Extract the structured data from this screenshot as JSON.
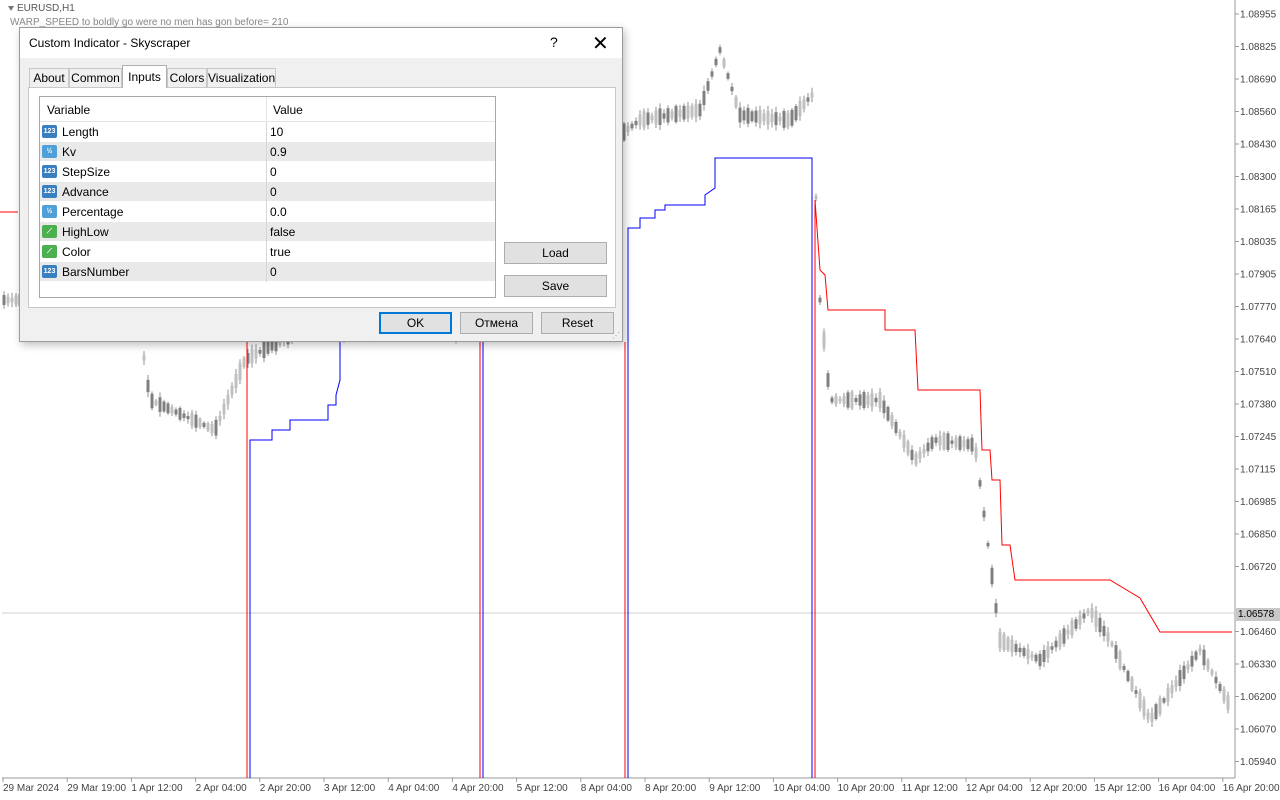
{
  "chart": {
    "symbol": "EURUSD,H1",
    "indicator_note": "WARP_SPEED to boldly go were no men has gon before= 210",
    "current_price": "1.06578",
    "price_ticks": [
      "1.08955",
      "1.08825",
      "1.08690",
      "1.08560",
      "1.08430",
      "1.08300",
      "1.08165",
      "1.08035",
      "1.07905",
      "1.07770",
      "1.07640",
      "1.07510",
      "1.07380",
      "1.07245",
      "1.07115",
      "1.06985",
      "1.06850",
      "1.06720",
      "1.06460",
      "1.06330",
      "1.06200",
      "1.06070",
      "1.05940"
    ],
    "time_ticks": [
      "29 Mar 2024",
      "29 Mar 19:00",
      "1 Apr 12:00",
      "2 Apr 04:00",
      "2 Apr 20:00",
      "3 Apr 12:00",
      "4 Apr 04:00",
      "4 Apr 20:00",
      "5 Apr 12:00",
      "8 Apr 04:00",
      "8 Apr 20:00",
      "9 Apr 12:00",
      "10 Apr 04:00",
      "10 Apr 20:00",
      "11 Apr 12:00",
      "12 Apr 04:00",
      "12 Apr 20:00",
      "15 Apr 12:00",
      "16 Apr 04:00",
      "16 Apr 20:00"
    ],
    "colors": {
      "bull": "#c0c0c0",
      "bear": "#808080",
      "up_line": "#0000ff",
      "down_line": "#ff0000",
      "grid": "#e0e0e0"
    }
  },
  "dialog": {
    "title": "Custom Indicator - Skyscraper",
    "help": "?",
    "close": "✕",
    "tabs": [
      "About",
      "Common",
      "Inputs",
      "Colors",
      "Visualization"
    ],
    "active_tab": "Inputs",
    "table": {
      "header_variable": "Variable",
      "header_value": "Value",
      "rows": [
        {
          "icon": "int-icon",
          "name": "Length",
          "value": "10"
        },
        {
          "icon": "double-icon",
          "name": "Kv",
          "value": "0.9"
        },
        {
          "icon": "int-icon",
          "name": "StepSize",
          "value": "0"
        },
        {
          "icon": "int-icon",
          "name": "Advance",
          "value": "0"
        },
        {
          "icon": "double-icon",
          "name": "Percentage",
          "value": "0.0"
        },
        {
          "icon": "bool-icon",
          "name": "HighLow",
          "value": "false"
        },
        {
          "icon": "bool-icon",
          "name": "Color",
          "value": "true"
        },
        {
          "icon": "int-icon",
          "name": "BarsNumber",
          "value": "0"
        }
      ]
    },
    "buttons": {
      "load": "Load",
      "save": "Save",
      "ok": "OK",
      "cancel": "Отмена",
      "reset": "Reset"
    }
  }
}
